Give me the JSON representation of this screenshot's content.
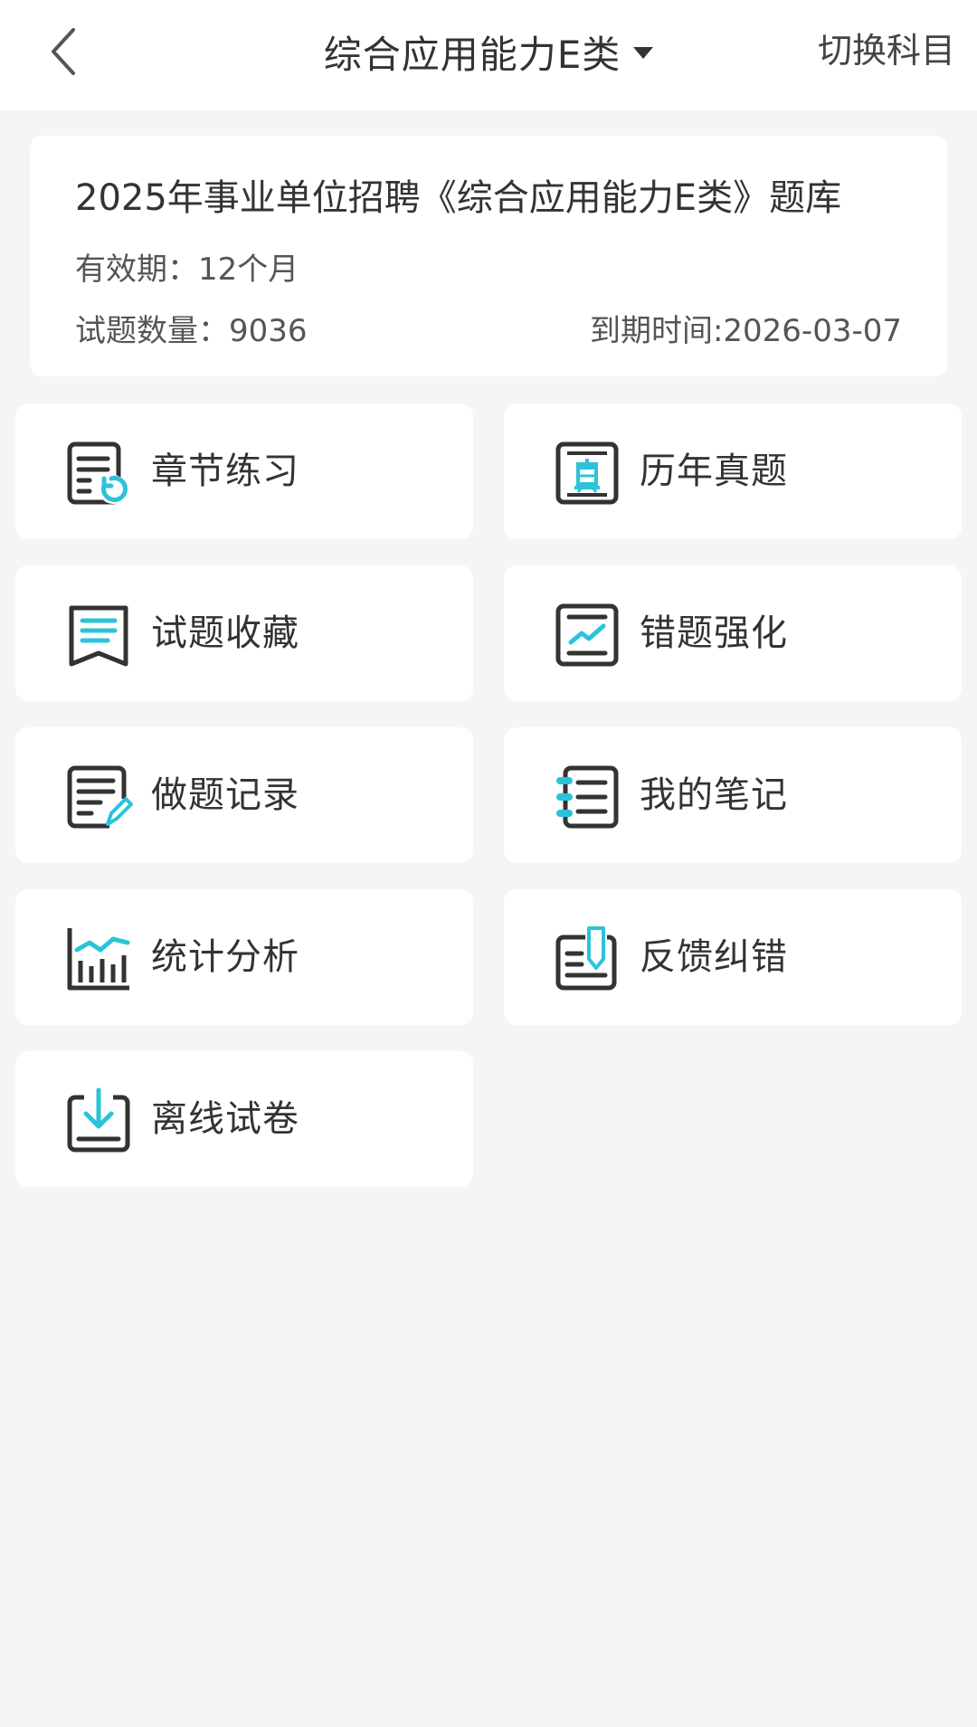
{
  "header": {
    "title": "综合应用能力E类",
    "switch_label": "切换科目"
  },
  "info": {
    "title": "2025年事业单位招聘《综合应用能力E类》题库",
    "validity": "有效期：12个月",
    "count": "试题数量：9036",
    "expire": "到期时间:2026-03-07"
  },
  "colors": {
    "accent": "#2bc3d9",
    "icon_dark": "#333333",
    "background": "#f5f5f5",
    "card": "#ffffff"
  },
  "menu": [
    {
      "label": "章节练习",
      "icon": "chapter-practice-icon"
    },
    {
      "label": "历年真题",
      "icon": "past-exams-icon"
    },
    {
      "label": "试题收藏",
      "icon": "bookmark-icon"
    },
    {
      "label": "错题强化",
      "icon": "wrong-questions-icon"
    },
    {
      "label": "做题记录",
      "icon": "records-icon"
    },
    {
      "label": "我的笔记",
      "icon": "notes-icon"
    },
    {
      "label": "统计分析",
      "icon": "statistics-icon"
    },
    {
      "label": "反馈纠错",
      "icon": "feedback-icon"
    },
    {
      "label": "离线试卷",
      "icon": "offline-download-icon"
    }
  ]
}
